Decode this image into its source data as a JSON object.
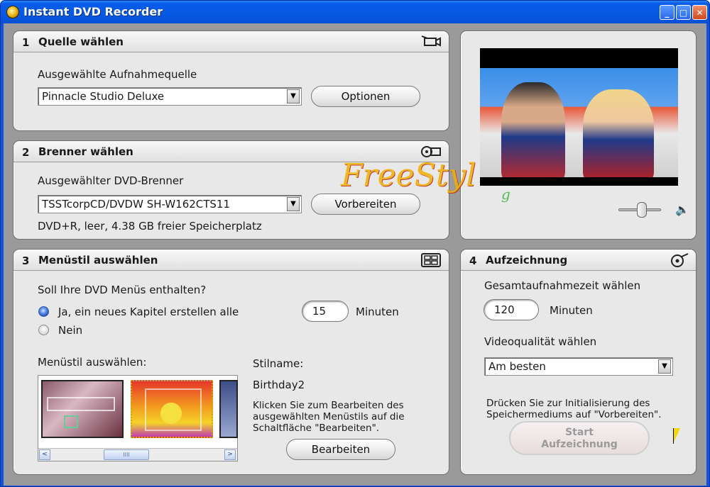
{
  "window": {
    "title": "Instant DVD Recorder",
    "minimize": "_",
    "maximize": "□",
    "close": "✕"
  },
  "panel1": {
    "number": "1",
    "title": "Quelle wählen",
    "icon": "camcorder-icon",
    "source_label": "Ausgewählte Aufnahmequelle",
    "source_value": "Pinnacle Studio Deluxe",
    "options_button": "Optionen"
  },
  "panel2": {
    "number": "2",
    "title": "Brenner wählen",
    "icon": "disc-burner-icon",
    "burner_label": "Ausgewählter DVD-Brenner",
    "burner_value": "TSSTcorpCD/DVDW SH-W162CTS11",
    "prepare_button": "Vorbereiten",
    "media_info": "DVD+R, leer, 4.38 GB freier Speicherplatz"
  },
  "panel3": {
    "number": "3",
    "title": "Menüstil auswählen",
    "icon": "menu-grid-icon",
    "question": "Soll Ihre DVD Menüs enthalten?",
    "option_yes": "Ja, ein neues Kapitel erstellen alle",
    "option_yes_selected": true,
    "chapter_interval": "15",
    "minutes_label": "Minuten",
    "option_no": "Nein",
    "style_label": "Menüstil auswählen:",
    "style_name_label": "Stilname:",
    "style_name_value": "Birthday2",
    "edit_hint": "Klicken Sie zum Bearbeiten des ausgewählten Menüstils auf die Schaltfläche \"Bearbeiten\".",
    "edit_button": "Bearbeiten",
    "scroll_left": "<",
    "scroll_right": ">",
    "scroll_grip": "IIII"
  },
  "preview": {
    "volume_level": 0.55,
    "speaker_glyph": "🔈"
  },
  "panel4": {
    "number": "4",
    "title": "Aufzeichnung",
    "icon": "record-disc-icon",
    "total_time_label": "Gesamtaufnahmezeit wählen",
    "total_time_value": "120",
    "minutes_label": "Minuten",
    "quality_label": "Videoqualität wählen",
    "quality_value": "Am besten",
    "init_hint": "Drücken Sie zur Initialisierung des Speichermediums auf \"Vorbereiten\".",
    "start_button_line1": "Start",
    "start_button_line2": "Aufzeichnung"
  },
  "watermark": {
    "text": "FreeStyl",
    "tail": "g"
  }
}
